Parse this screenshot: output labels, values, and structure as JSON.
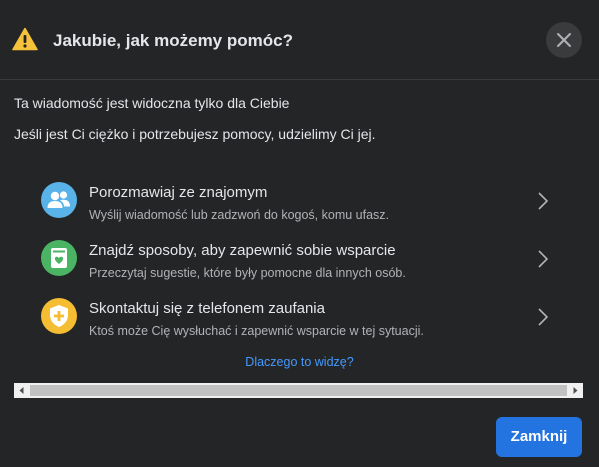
{
  "dialog": {
    "title": "Jakubie, jak możemy pomóc?",
    "notice": "Ta wiadomość jest widoczna tylko dla Ciebie",
    "intro": "Jeśli jest Ci ciężko i potrzebujesz pomocy, udzielimy Ci jej.",
    "options": [
      {
        "title": "Porozmawiaj ze znajomym",
        "description": "Wyślij wiadomość lub zadzwoń do kogoś, komu ufasz.",
        "icon": "people-icon",
        "color": "#5ab3e8"
      },
      {
        "title": "Znajdź sposoby, aby zapewnić sobie wsparcie",
        "description": "Przeczytaj sugestie, które były pomocne dla innych osób.",
        "icon": "heart-document-icon",
        "color": "#4ab464"
      },
      {
        "title": "Skontaktuj się z telefonem zaufania",
        "description": "Ktoś może Cię wysłuchać i zapewnić wsparcie w tej sytuacji.",
        "icon": "shield-plus-icon",
        "color": "#f5bd32"
      }
    ],
    "why_link": "Dlaczego to widzę?",
    "close_button": "Zamknij"
  },
  "colors": {
    "background": "#242526",
    "accent": "#2374e1",
    "link": "#4599ff",
    "warning": "#f5c33b"
  }
}
